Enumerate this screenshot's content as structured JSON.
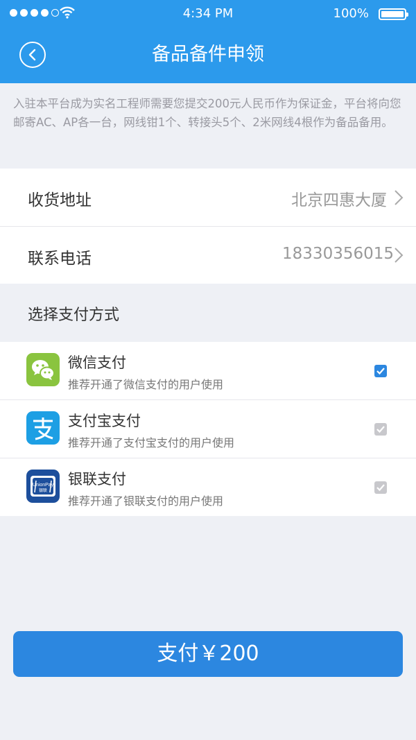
{
  "status_bar": {
    "time": "4:34 PM",
    "battery": "100%"
  },
  "header": {
    "title": "备品备件申领"
  },
  "notice": "入驻本平台成为实名工程师需要您提交200元人民币作为保证金，平台将向您邮寄AC、AP各一台，网线钳1个、转接头5个、2米网线4根作为备品备用。",
  "address": {
    "label": "收货地址",
    "value": "北京四惠大厦"
  },
  "phone": {
    "label": "联系电话",
    "value": "18330356015"
  },
  "payment": {
    "section_title": "选择支付方式",
    "methods": [
      {
        "name": "微信支付",
        "desc": "推荐开通了微信支付的用户使用",
        "icon": "wechat-pay-icon",
        "checked": true
      },
      {
        "name": "支付宝支付",
        "desc": "推荐开通了支付宝支付的用户使用",
        "icon": "alipay-icon",
        "checked": false
      },
      {
        "name": "银联支付",
        "desc": "推荐开通了银联支付的用户使用",
        "icon": "unionpay-icon",
        "checked": false
      }
    ]
  },
  "unionpay_logo": {
    "line1": "UnionPay",
    "line2": "银联"
  },
  "pay_button": {
    "label": "支付￥200"
  },
  "colors": {
    "primary": "#2c9aec",
    "button": "#2c87e0",
    "wechat": "#8ac43f",
    "alipay": "#1d9fe4",
    "unionpay": "#1d4f9c"
  }
}
